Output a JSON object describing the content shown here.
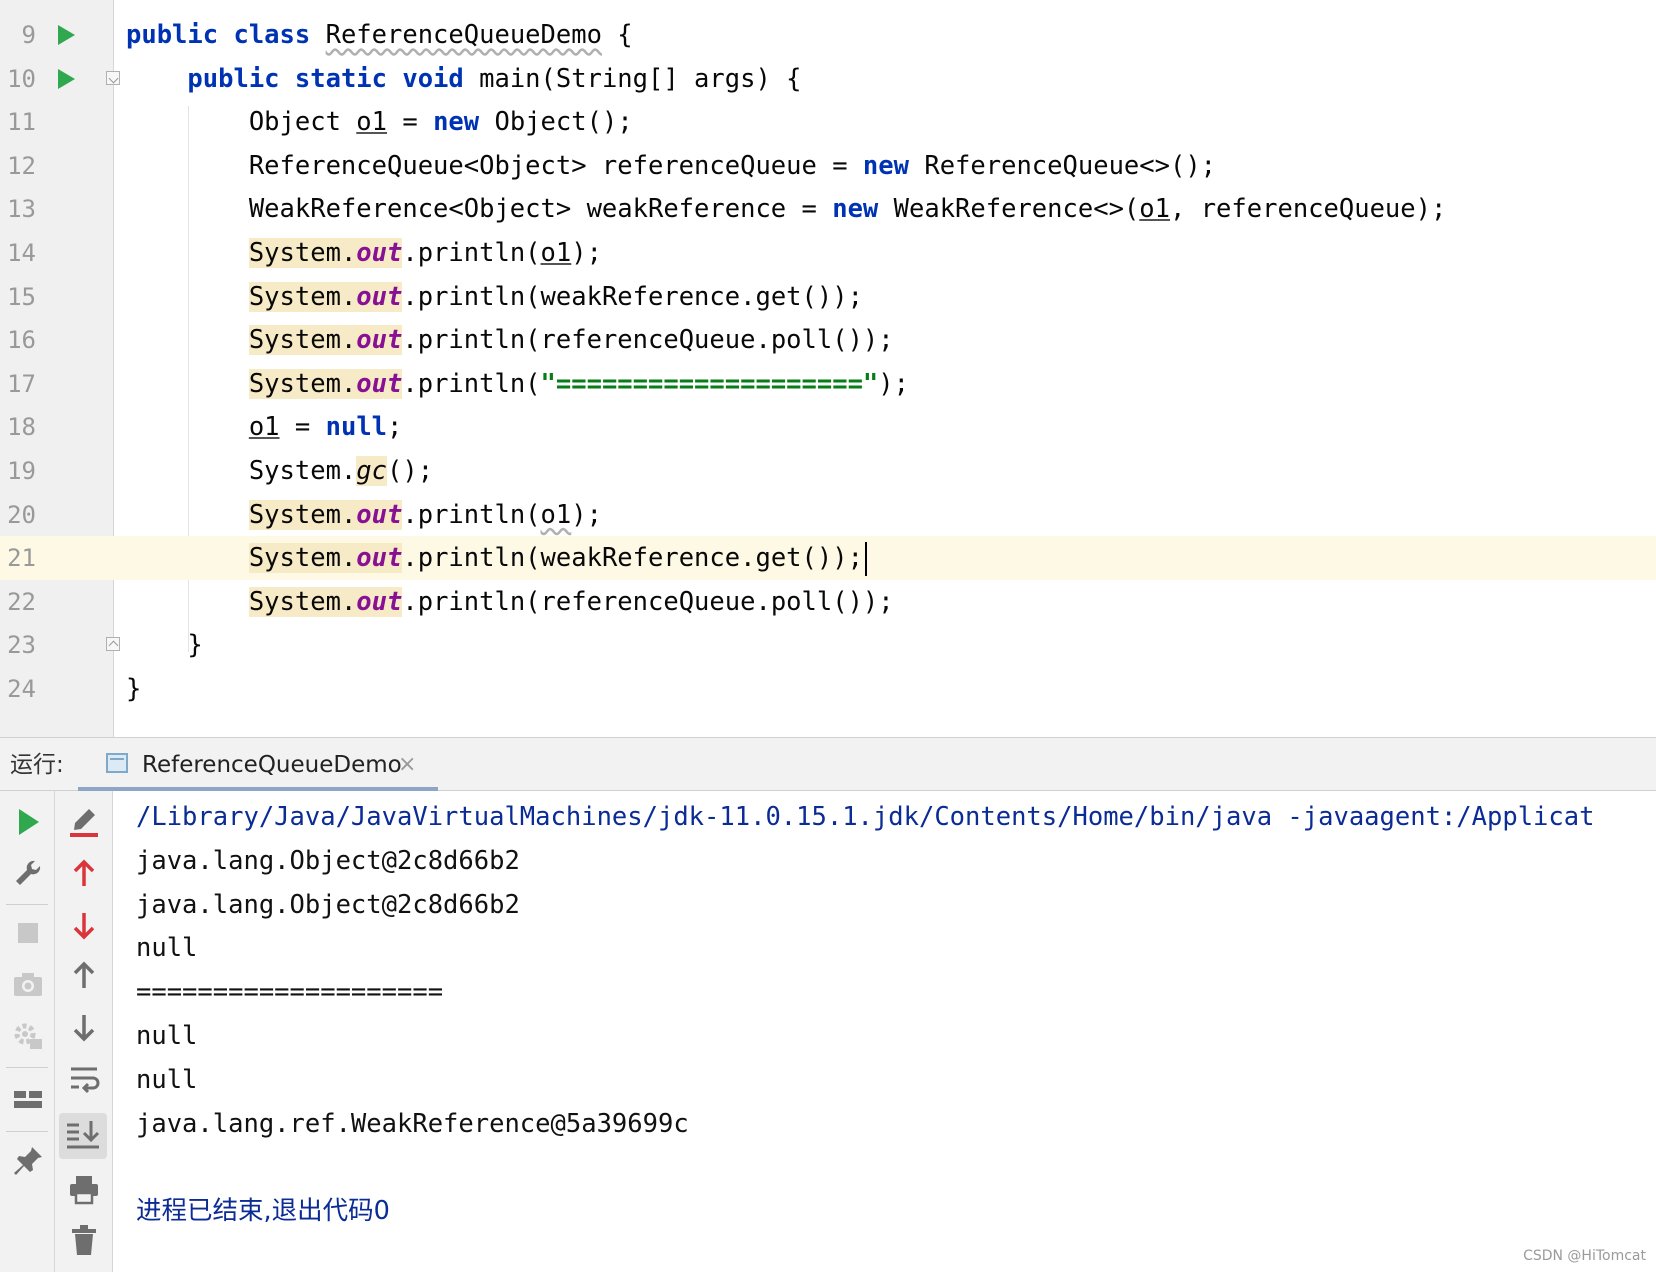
{
  "editor": {
    "lines": [
      {
        "num": "9",
        "parts": [
          {
            "t": "public class ",
            "c": "kw"
          },
          {
            "t": "ReferenceQueueDemo",
            "c": "wavy"
          },
          {
            "t": " {",
            "c": ""
          }
        ]
      },
      {
        "num": "10",
        "parts": [
          {
            "t": "    ",
            "c": ""
          },
          {
            "t": "public static void ",
            "c": "kw"
          },
          {
            "t": "main(String[] args) {",
            "c": ""
          }
        ]
      },
      {
        "num": "11",
        "parts": [
          {
            "t": "        Object ",
            "c": ""
          },
          {
            "t": "o1",
            "c": "ul"
          },
          {
            "t": " = ",
            "c": ""
          },
          {
            "t": "new ",
            "c": "kw"
          },
          {
            "t": "Object();",
            "c": ""
          }
        ]
      },
      {
        "num": "12",
        "parts": [
          {
            "t": "        ReferenceQueue<Object> referenceQueue = ",
            "c": ""
          },
          {
            "t": "new ",
            "c": "kw"
          },
          {
            "t": "ReferenceQueue<>();",
            "c": ""
          }
        ]
      },
      {
        "num": "13",
        "parts": [
          {
            "t": "        WeakReference<Object> weakReference = ",
            "c": ""
          },
          {
            "t": "new ",
            "c": "kw"
          },
          {
            "t": "WeakReference<>(",
            "c": ""
          },
          {
            "t": "o1",
            "c": "ul"
          },
          {
            "t": ", referenceQueue);",
            "c": ""
          }
        ]
      },
      {
        "num": "14",
        "parts": [
          {
            "t": "        ",
            "c": ""
          },
          {
            "t": "System.",
            "c": "hl"
          },
          {
            "t": "out",
            "c": "hl fld"
          },
          {
            "t": ".println(",
            "c": ""
          },
          {
            "t": "o1",
            "c": "ul"
          },
          {
            "t": ");",
            "c": ""
          }
        ]
      },
      {
        "num": "15",
        "parts": [
          {
            "t": "        ",
            "c": ""
          },
          {
            "t": "System.",
            "c": "hl"
          },
          {
            "t": "out",
            "c": "hl fld"
          },
          {
            "t": ".println(weakReference.get());",
            "c": ""
          }
        ]
      },
      {
        "num": "16",
        "parts": [
          {
            "t": "        ",
            "c": ""
          },
          {
            "t": "System.",
            "c": "hl"
          },
          {
            "t": "out",
            "c": "hl fld"
          },
          {
            "t": ".println(referenceQueue.poll());",
            "c": ""
          }
        ]
      },
      {
        "num": "17",
        "parts": [
          {
            "t": "        ",
            "c": ""
          },
          {
            "t": "System.",
            "c": "hl"
          },
          {
            "t": "out",
            "c": "hl fld"
          },
          {
            "t": ".println(",
            "c": ""
          },
          {
            "t": "\"====================\"",
            "c": "str"
          },
          {
            "t": ");",
            "c": ""
          }
        ]
      },
      {
        "num": "18",
        "parts": [
          {
            "t": "        ",
            "c": ""
          },
          {
            "t": "o1",
            "c": "ul"
          },
          {
            "t": " = ",
            "c": ""
          },
          {
            "t": "null",
            "c": "kw"
          },
          {
            "t": ";",
            "c": ""
          }
        ]
      },
      {
        "num": "19",
        "parts": [
          {
            "t": "        System.",
            "c": ""
          },
          {
            "t": "gc",
            "c": "hl ital"
          },
          {
            "t": "();",
            "c": ""
          }
        ]
      },
      {
        "num": "20",
        "parts": [
          {
            "t": "        ",
            "c": ""
          },
          {
            "t": "System.",
            "c": "hl"
          },
          {
            "t": "out",
            "c": "hl fld"
          },
          {
            "t": ".println(",
            "c": ""
          },
          {
            "t": "o1",
            "c": "wavy"
          },
          {
            "t": ");",
            "c": ""
          }
        ]
      },
      {
        "num": "21",
        "parts": [
          {
            "t": "        ",
            "c": ""
          },
          {
            "t": "System.",
            "c": "hl"
          },
          {
            "t": "out",
            "c": "hl fld"
          },
          {
            "t": ".println(weakReference.get());",
            "c": ""
          }
        ]
      },
      {
        "num": "22",
        "parts": [
          {
            "t": "        ",
            "c": ""
          },
          {
            "t": "System.",
            "c": "hl"
          },
          {
            "t": "out",
            "c": "hl fld"
          },
          {
            "t": ".println(referenceQueue.poll());",
            "c": ""
          }
        ]
      },
      {
        "num": "23",
        "parts": [
          {
            "t": "    }",
            "c": ""
          }
        ]
      },
      {
        "num": "24",
        "parts": [
          {
            "t": "}",
            "c": ""
          }
        ]
      }
    ],
    "current_line": "21",
    "run_gutter_lines": [
      "9",
      "10"
    ]
  },
  "run_panel": {
    "label": "运行:",
    "tab_label": "ReferenceQueueDemo",
    "tab_close": "×",
    "console_lines": [
      "/Library/Java/JavaVirtualMachines/jdk-11.0.15.1.jdk/Contents/Home/bin/java -javaagent:/Applicat",
      "java.lang.Object@2c8d66b2",
      "java.lang.Object@2c8d66b2",
      "null",
      "====================",
      "null",
      "null",
      "java.lang.ref.WeakReference@5a39699c",
      "",
      "进程已结束,退出代码0"
    ],
    "left_tools": [
      "rerun-icon",
      "wrench-icon",
      "stop-icon",
      "camera-icon",
      "debug-settings-icon",
      "layout-icon",
      "pin-icon"
    ],
    "mid_tools": [
      "clear-marker-icon",
      "arrow-up-red-icon",
      "arrow-down-red-icon",
      "arrow-up-icon",
      "arrow-down-icon",
      "soft-wrap-icon",
      "scroll-to-end-icon",
      "print-icon",
      "trash-icon"
    ]
  },
  "colors": {
    "keyword": "#0033b3",
    "string": "#067d17",
    "static_field": "#871094",
    "run_green": "#2fa84f",
    "error_red": "#d9353b"
  },
  "watermark": "CSDN @HiTomcat"
}
